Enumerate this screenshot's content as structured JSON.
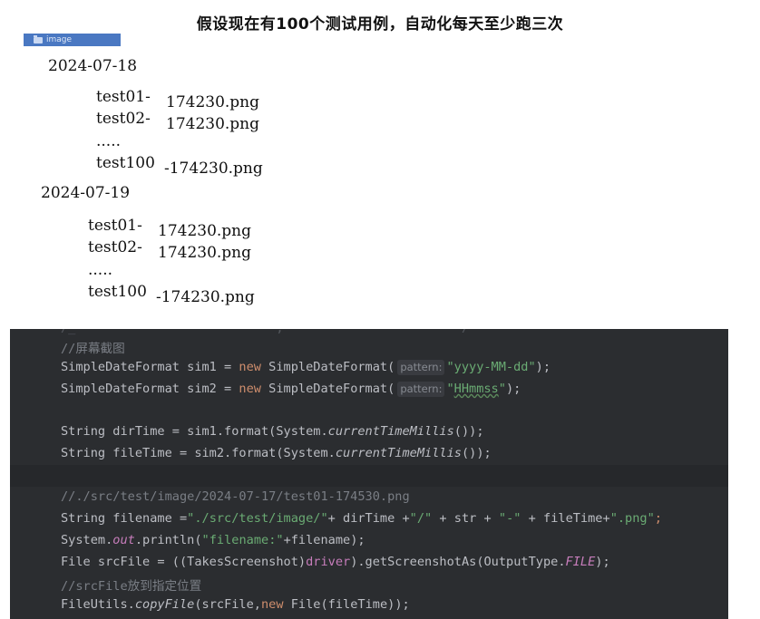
{
  "title": "假设现在有100个测试用例，自动化每天至少跑三次",
  "folder": {
    "label": "image",
    "icon": "folder-icon"
  },
  "groups": [
    {
      "date": "2024-07-18",
      "files": [
        "test01-",
        "test02-",
        ".....",
        "test100"
      ],
      "suffixes": [
        "174230.png",
        "174230.png",
        "",
        "-174230.png"
      ]
    },
    {
      "date": "2024-07-19",
      "files": [
        "test01-",
        "test02-",
        ".....",
        "test100"
      ],
      "suffixes": [
        "174230.png",
        "174230.png",
        "",
        "-174230.png"
      ]
    }
  ],
  "code": {
    "comment_screenshot": "//屏幕截图",
    "sim1_pre": "SimpleDateFormat sim1 = ",
    "sim2_pre": "SimpleDateFormat sim2 = ",
    "kw_new": "new",
    "sdf_ctor": " SimpleDateFormat(",
    "hint_pattern": "pattern:",
    "fmt_date": "\"yyyy-MM-dd\"",
    "fmt_time_q1": "\"",
    "fmt_time_inner": "HHmmss",
    "fmt_time_q2": "\"",
    "close_paren_semi": ");",
    "dir_pre": "String dirTime = sim1.format(System.",
    "file_pre": "String fileTime = sim2.format(System.",
    "ctm": "currentTimeMillis",
    "ctm_close": "());",
    "comment_path": "//./src/test/image/2024-07-17/test01-174530.png",
    "fn_pre": "String filename =",
    "fn_s1": "\"./src/test/image/\"",
    "fn_mid1": "+ dirTime +",
    "fn_s2": "\"/\"",
    "fn_mid2": " + str + ",
    "fn_s3": "\"-\"",
    "fn_mid3": " + fileTime+",
    "fn_s4": "\".png\"",
    "fn_end": ";",
    "sys": "System.",
    "out": "out",
    "println": ".println(",
    "pr_str": "\"filename:\"",
    "pr_end": "+filename);",
    "src_pre": "File srcFile = ((TakesScreenshot)",
    "driver": "driver",
    "src_mid": ").getScreenshotAs(OutputType.",
    "file_const": "FILE",
    "src_end": ");",
    "comment_move": "//srcFile放到指定位置",
    "fu_pre": "FileUtils.",
    "copy": "copyFile",
    "fu_mid": "(srcFile,",
    "fu_end": " File(fileTime));"
  }
}
